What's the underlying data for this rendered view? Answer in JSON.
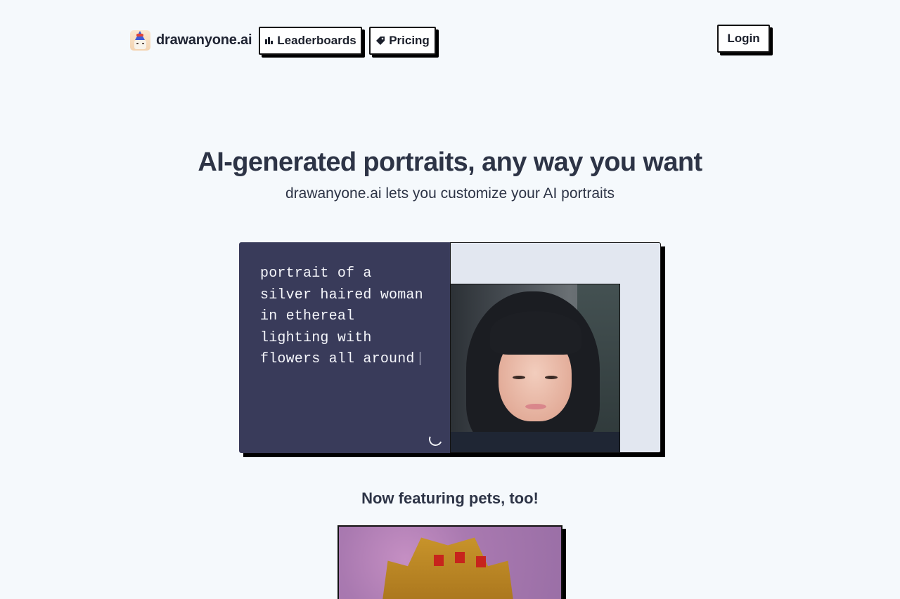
{
  "header": {
    "brand_name": "drawanyone.ai",
    "nav": {
      "leaderboards_label": "Leaderboards",
      "pricing_label": "Pricing",
      "login_label": "Login"
    },
    "icons": {
      "logo": "app-logo-icon",
      "leaderboards": "bar-chart-icon",
      "pricing": "price-tag-icon"
    }
  },
  "hero": {
    "title": "AI-generated portraits, any way you want",
    "subtitle": "drawanyone.ai lets you customize your AI portraits"
  },
  "demo": {
    "prompt": "portrait of a\nsilver haired woman\nin ethereal\nlighting with\nflowers all around",
    "caret": "|",
    "loading_icon": "loading-spinner-icon",
    "colors": {
      "prompt_bg": "#393b5a",
      "image_bg": "#e2e7f0"
    }
  },
  "pets": {
    "title": "Now featuring pets, too!"
  },
  "colors": {
    "page_bg": "#f5f9fc",
    "text": "#2d3446",
    "border": "#111111"
  }
}
